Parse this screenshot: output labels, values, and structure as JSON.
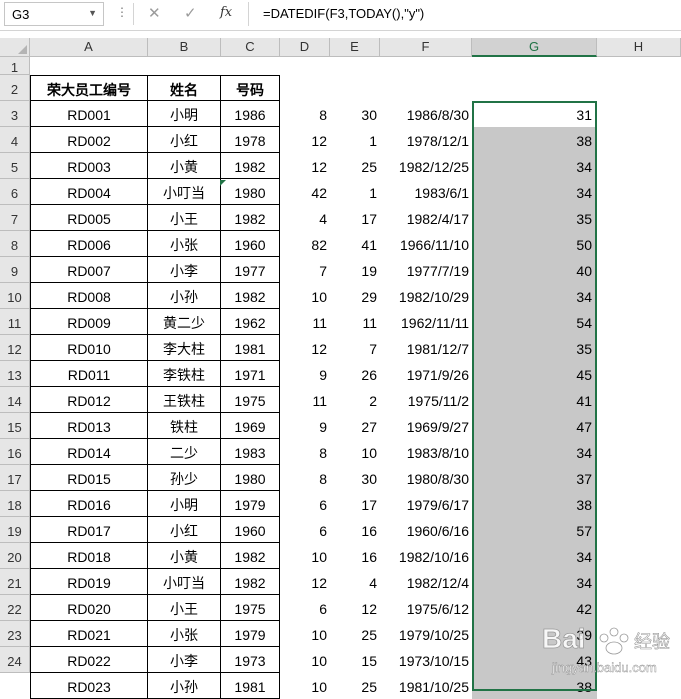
{
  "formula_bar": {
    "name_box": "G3",
    "dots": "⋮",
    "cancel_glyph": "✕",
    "enter_glyph": "✓",
    "fx_label": "fx",
    "formula": "=DATEDIF(F3,TODAY(),\"y\")"
  },
  "columns": [
    "A",
    "B",
    "C",
    "D",
    "E",
    "F",
    "G",
    "H"
  ],
  "row_numbers": [
    "1",
    "2",
    "3",
    "4",
    "5",
    "6",
    "7",
    "8",
    "9",
    "10",
    "11",
    "12",
    "13",
    "14",
    "15",
    "16",
    "17",
    "18",
    "19",
    "20",
    "21",
    "22",
    "23",
    "24"
  ],
  "headers": {
    "a": "荣大员工编号",
    "b": "姓名",
    "c": "号码"
  },
  "rows": [
    [
      "RD001",
      "小明",
      "1986",
      "8",
      "30",
      "1986/8/30",
      "31"
    ],
    [
      "RD002",
      "小红",
      "1978",
      "12",
      "1",
      "1978/12/1",
      "38"
    ],
    [
      "RD003",
      "小黄",
      "1982",
      "12",
      "25",
      "1982/12/25",
      "34"
    ],
    [
      "RD004",
      "小叮当",
      "1980",
      "42",
      "1",
      "1983/6/1",
      "34"
    ],
    [
      "RD005",
      "小王",
      "1982",
      "4",
      "17",
      "1982/4/17",
      "35"
    ],
    [
      "RD006",
      "小张",
      "1960",
      "82",
      "41",
      "1966/11/10",
      "50"
    ],
    [
      "RD007",
      "小李",
      "1977",
      "7",
      "19",
      "1977/7/19",
      "40"
    ],
    [
      "RD008",
      "小孙",
      "1982",
      "10",
      "29",
      "1982/10/29",
      "34"
    ],
    [
      "RD009",
      "黄二少",
      "1962",
      "11",
      "11",
      "1962/11/11",
      "54"
    ],
    [
      "RD010",
      "李大柱",
      "1981",
      "12",
      "7",
      "1981/12/7",
      "35"
    ],
    [
      "RD011",
      "李铁柱",
      "1971",
      "9",
      "26",
      "1971/9/26",
      "45"
    ],
    [
      "RD012",
      "王铁柱",
      "1975",
      "11",
      "2",
      "1975/11/2",
      "41"
    ],
    [
      "RD013",
      "铁柱",
      "1969",
      "9",
      "27",
      "1969/9/27",
      "47"
    ],
    [
      "RD014",
      "二少",
      "1983",
      "8",
      "10",
      "1983/8/10",
      "34"
    ],
    [
      "RD015",
      "孙少",
      "1980",
      "8",
      "30",
      "1980/8/30",
      "37"
    ],
    [
      "RD016",
      "小明",
      "1979",
      "6",
      "17",
      "1979/6/17",
      "38"
    ],
    [
      "RD017",
      "小红",
      "1960",
      "6",
      "16",
      "1960/6/16",
      "57"
    ],
    [
      "RD018",
      "小黄",
      "1982",
      "10",
      "16",
      "1982/10/16",
      "34"
    ],
    [
      "RD019",
      "小叮当",
      "1982",
      "12",
      "4",
      "1982/12/4",
      "34"
    ],
    [
      "RD020",
      "小王",
      "1975",
      "6",
      "12",
      "1975/6/12",
      "42"
    ],
    [
      "RD021",
      "小张",
      "1979",
      "10",
      "25",
      "1979/10/25",
      "39"
    ],
    [
      "RD022",
      "小李",
      "1973",
      "10",
      "15",
      "1973/10/15",
      "43"
    ],
    [
      "RD023",
      "小孙",
      "1981",
      "10",
      "25",
      "1981/10/25",
      "38"
    ]
  ],
  "watermark": {
    "brand": "Bai",
    "suffix": "经验",
    "url": "jingyan.baidu.com"
  },
  "colors": {
    "selection": "#217346",
    "header_bg": "#e6e6e6",
    "selected_fill": "#c8c8c8"
  }
}
